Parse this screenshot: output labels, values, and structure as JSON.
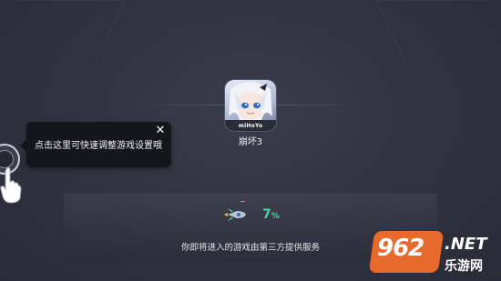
{
  "app": {
    "name": "崩坏3",
    "brand": "miHoYo",
    "icon": "game-character-icon"
  },
  "tooltip": {
    "text": "点击这里可快速调整游戏设置哦",
    "close_icon": "close-icon"
  },
  "loading": {
    "progress_value": "7",
    "progress_unit": "%",
    "progress_fraction": 0.07,
    "icon": "rocket-icon",
    "notice": "你即将进入的游戏由第三方提供服务"
  },
  "floating_ball": {
    "icon": "floating-menu-icon",
    "hint_icon": "hand-pointer-icon"
  },
  "watermark": {
    "number": "962",
    "suffix": ".NET",
    "site": "乐游网"
  },
  "colors": {
    "accent": "#45d6a4",
    "background": "#30323f",
    "tooltip_bg": "#15161c",
    "watermark_orange": "#e8692c"
  }
}
